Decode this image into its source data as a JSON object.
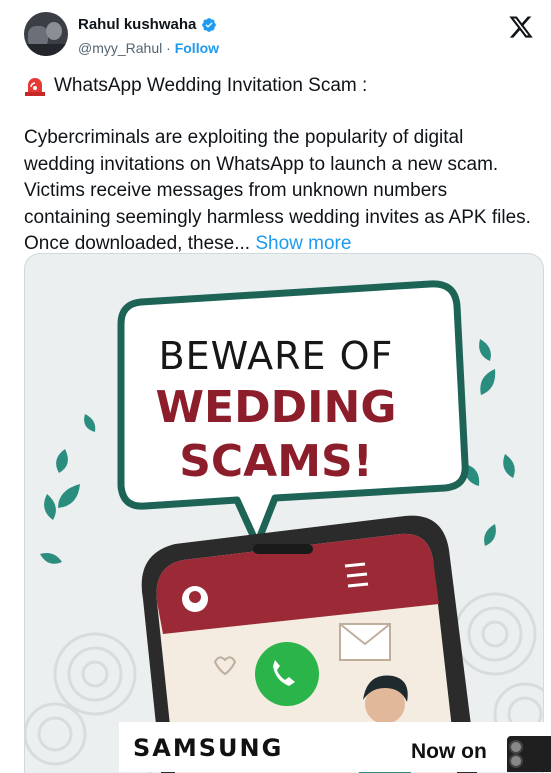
{
  "author": {
    "name": "Rahul kushwaha",
    "handle": "@myy_Rahul",
    "separator": "·",
    "follow_label": "Follow",
    "verified_icon": "verified-badge-icon",
    "accent_color": "#1d9bf0"
  },
  "post": {
    "title": "WhatsApp Wedding Invitation Scam :",
    "title_icon": "siren-icon",
    "body": "Cybercriminals are exploiting the popularity of digital wedding invitations on WhatsApp to launch a new scam. Victims receive messages from unknown numbers containing seemingly harmless wedding invites as APK files. Once downloaded, these...",
    "show_more_label": "Show more"
  },
  "image": {
    "line1": "BEWARE OF",
    "line2": "WEDDING",
    "line3": "SCAMS!",
    "accent_color": "#8c1d2a",
    "bubble_border_color": "#1d6457"
  },
  "ad": {
    "brand": "SAMSUNG",
    "tagline": "Now on"
  }
}
